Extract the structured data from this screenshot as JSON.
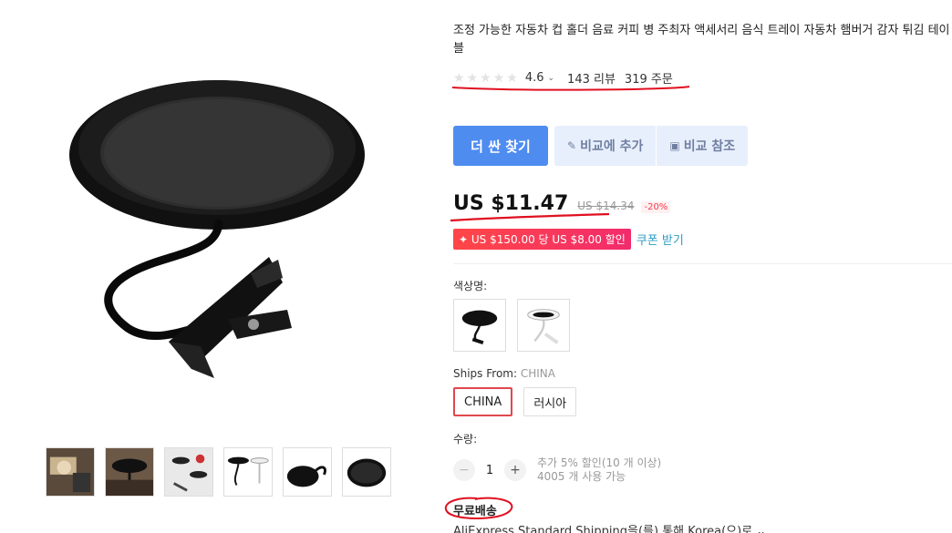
{
  "product": {
    "title": "조정 가능한 자동차 컵 홀더 음료 커피 병 주최자 액세서리 음식 트레이 자동차 햄버거 감자 튀김 테이블",
    "rating": "4.6",
    "reviews": "143 리뷰",
    "orders": "319 주문"
  },
  "actions": {
    "find_cheaper": "더 싼 찾기",
    "add_compare": "비교에 추가",
    "view_compare": "비교 참조"
  },
  "pricing": {
    "price": "US $11.47",
    "original_price": "US $14.34",
    "discount": "-20%",
    "coupon_tag": "✦ US $150.00 당 US $8.00 할인",
    "coupon_link": "쿠폰 받기"
  },
  "options": {
    "color_label": "색상명:",
    "ships_from_label": "Ships From:",
    "ships_from_value": "CHINA",
    "ship_options": [
      "CHINA",
      "러시아"
    ],
    "quantity_label": "수량:",
    "quantity_value": "1",
    "quantity_note_1": "추가 5% 할인(10 개 이상)",
    "quantity_note_2": "4005 개 사용 가능"
  },
  "shipping": {
    "free_label": "무료배송",
    "method": "AliExpress Standard Shipping을(를) 통해 Korea(으)로 ⌄"
  },
  "colors": {
    "accent": "#4f8cf0",
    "sale_red": "#fd384f",
    "annotation_red": "#e01020",
    "link": "#2e9cc3"
  }
}
